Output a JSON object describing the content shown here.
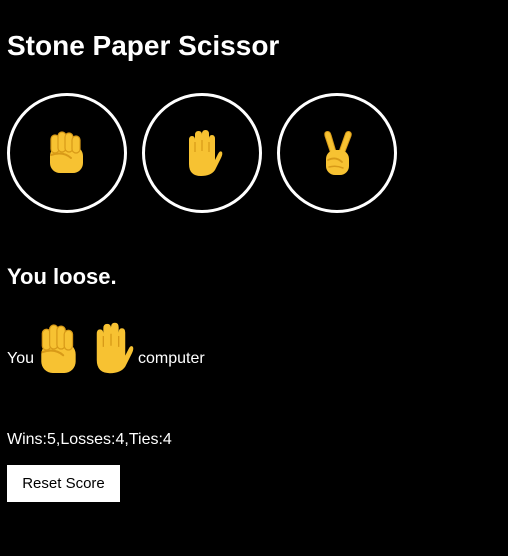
{
  "title": "Stone Paper Scissor",
  "choices": [
    {
      "id": "stone",
      "icon": "raised-fist-icon"
    },
    {
      "id": "paper",
      "icon": "raised-hand-icon"
    },
    {
      "id": "scissor",
      "icon": "victory-hand-icon"
    }
  ],
  "result": {
    "text": "You loose."
  },
  "moves": {
    "you_label": "You",
    "you_icon": "raised-fist-icon",
    "computer_icon": "raised-hand-icon",
    "computer_label": "computer"
  },
  "score": {
    "text": "Wins:5,Losses:4,Ties:4"
  },
  "reset_button": {
    "label": "Reset Score"
  },
  "colors": {
    "background": "#000000",
    "text": "#ffffff",
    "emoji_yellow": "#F7C232",
    "emoji_shade": "#D89A18"
  }
}
